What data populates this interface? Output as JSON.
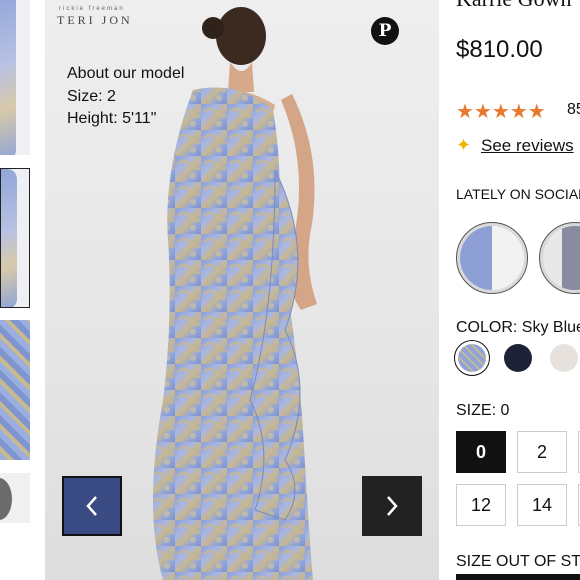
{
  "product": {
    "name": "Karrie Gown",
    "price": "$810.00",
    "rating_stars": 5,
    "review_count": "85",
    "see_reviews": "See reviews",
    "social_heading": "LATELY ON SOCIAL",
    "color_label": "COLOR: Sky Blue",
    "colors": [
      {
        "name": "Sky Blue",
        "hex": "#8fa4da",
        "selected": true
      },
      {
        "name": "Navy",
        "hex": "#1e2236"
      },
      {
        "name": "Champagne",
        "hex": "#e6e1dc"
      }
    ],
    "size_label": "SIZE: 0",
    "sizes": [
      "0",
      "2",
      "12",
      "14"
    ],
    "selected_size": "0",
    "out_of_stock": "SIZE OUT OF STOCK?"
  },
  "image": {
    "brand_small": "rickie freeman",
    "brand": "TERI JON",
    "model_title": "About our model",
    "model_size": "Size: 2",
    "model_height": "Height: 5'11\"",
    "pin_icon": "pinterest-icon",
    "prev_icon": "chevron-left-icon",
    "next_icon": "chevron-right-icon"
  },
  "colors": {
    "star": "#e8792f",
    "accent_dark": "#111111",
    "prev_button": "#3a4a82",
    "next_button": "#222222"
  }
}
